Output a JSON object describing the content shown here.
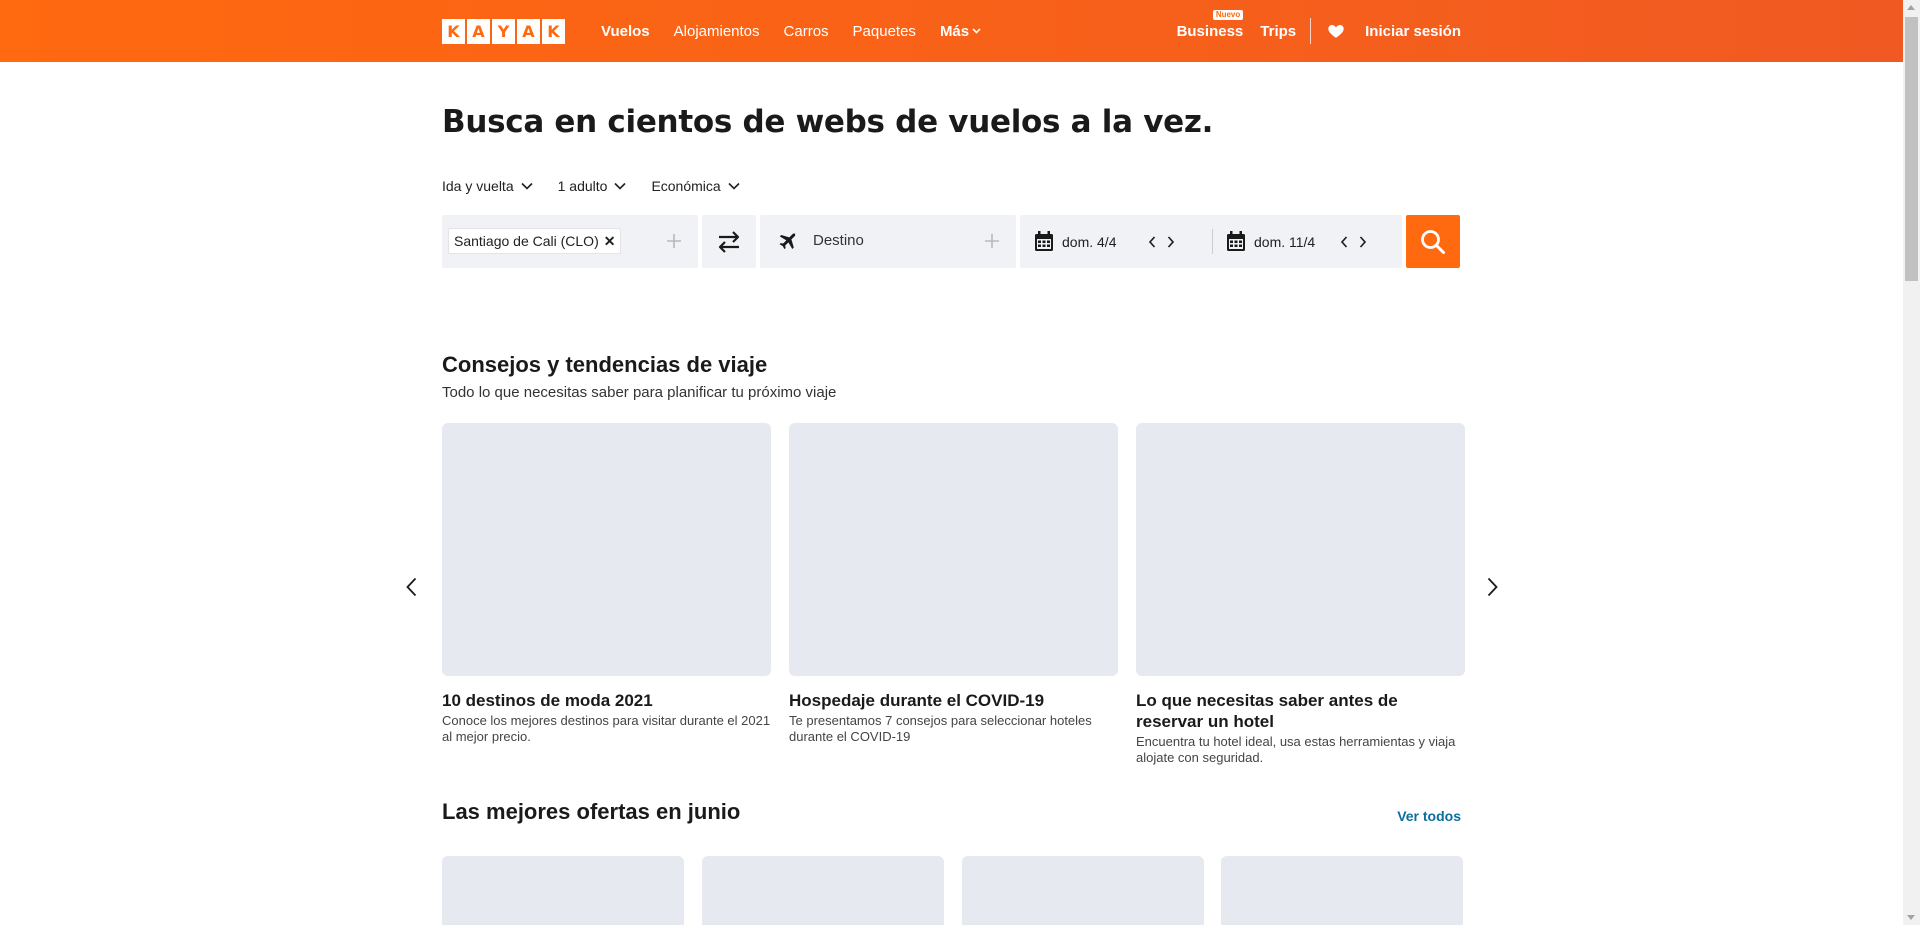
{
  "header": {
    "logo_letters": [
      "K",
      "A",
      "Y",
      "A",
      "K"
    ],
    "nav": [
      "Vuelos",
      "Alojamientos",
      "Carros",
      "Paquetes"
    ],
    "more_label": "Más",
    "business_label": "Business",
    "business_badge": "Nuevo",
    "trips_label": "Trips",
    "signin_label": "Iniciar sesión"
  },
  "hero": {
    "title": "Busca en cientos de webs de vuelos a la vez."
  },
  "search_options": {
    "trip_type": "Ida y vuelta",
    "passengers": "1 adulto",
    "cabin": "Económica"
  },
  "search": {
    "origin_chip": "Santiago de Cali (CLO)",
    "remove_glyph": "✕",
    "destination_placeholder": "Destino",
    "depart_date": "dom. 4/4",
    "return_date": "dom. 11/4"
  },
  "tips": {
    "title": "Consejos y tendencias de viaje",
    "subtitle": "Todo lo que necesitas saber para planificar tu próximo viaje",
    "cards": [
      {
        "title": "10 destinos de moda 2021",
        "desc": "Conoce los mejores destinos para visitar durante el 2021 al mejor precio."
      },
      {
        "title": "Hospedaje durante el COVID-19",
        "desc": "Te presentamos 7 consejos para seleccionar hoteles durante el COVID-19"
      },
      {
        "title": "Lo que necesitas saber antes de reservar un hotel",
        "desc": "Encuentra tu hotel ideal, usa estas herramientas y viaja alojate con seguridad."
      }
    ]
  },
  "offers": {
    "title": "Las mejores ofertas en junio",
    "see_all": "Ver todos"
  },
  "colors": {
    "brand": "#ff690f",
    "link": "#0a6f9e",
    "placeholder_bg": "#e6e9ef"
  }
}
